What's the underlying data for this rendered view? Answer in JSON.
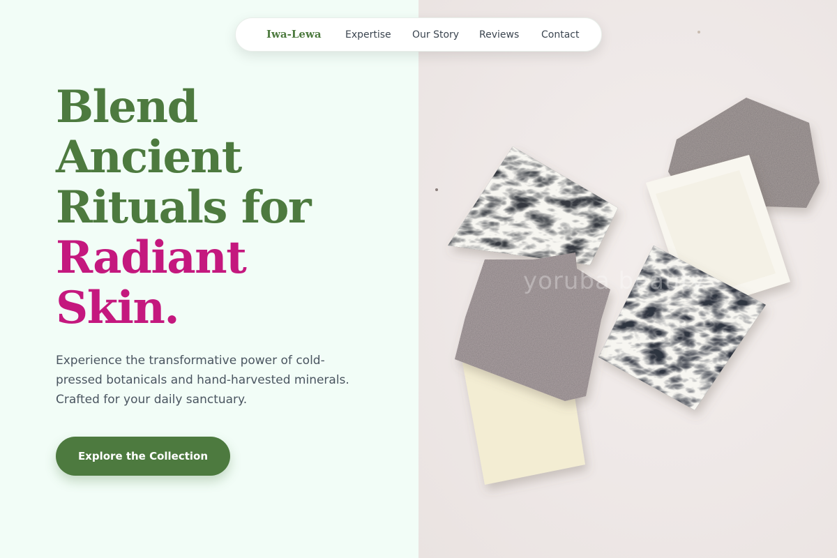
{
  "nav": {
    "brand": "Iwa-Lewa",
    "links": [
      "Expertise",
      "Our Story",
      "Reviews",
      "Contact"
    ]
  },
  "hero": {
    "headline_lines": [
      "Blend",
      "Ancient",
      "Rituals for",
      "Radiant",
      "Skin."
    ],
    "lede_lines": [
      "Experience the transformative power of cold-",
      "pressed botanicals and hand-harvested minerals.",
      "Crafted for your daily sanctuary."
    ],
    "cta_label": "Explore the Collection"
  },
  "image": {
    "watermark": "yoruba beauty"
  },
  "colors": {
    "brand_green": "#4d7a3f",
    "accent_pink": "#c4187e",
    "panel_bg": "#f2fdf7",
    "text_body": "#4a5560"
  }
}
